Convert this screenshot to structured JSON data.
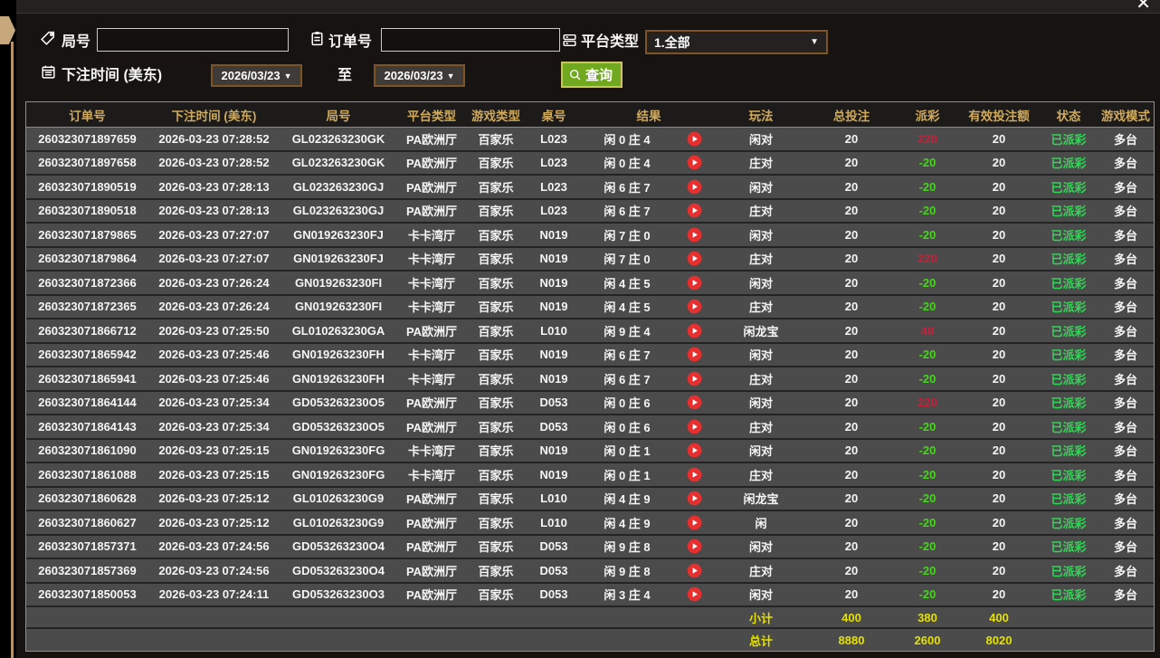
{
  "window": {
    "close_icon": "✕"
  },
  "colors": {
    "header_gold": "#cfa95c",
    "payout_negative_green": "#46d41c",
    "payout_positive_red": "#c3223a",
    "status_green": "#30d754",
    "totals_yellow": "#e4e000",
    "query_button_green": "#70a91f",
    "row_gray": "#4b4b4b"
  },
  "toolbar": {
    "round_label": "局号",
    "round_input_value": "",
    "round_input_placeholder": "",
    "order_label": "订单号",
    "order_input_value": "",
    "order_input_placeholder": "",
    "platform_label": "平台类型",
    "platform_value": "1.全部",
    "dropdown_arrow": "▼",
    "bet_time_label": "下注时间 (美东)",
    "date_from": "2026/03/23",
    "to_label": "至",
    "date_to": "2026/03/23",
    "query_label": "查询"
  },
  "table": {
    "headers": [
      "订单号",
      "下注时间 (美东)",
      "局号",
      "平台类型",
      "游戏类型",
      "桌号",
      "结果",
      "玩法",
      "总投注",
      "派彩",
      "有效投注额",
      "状态",
      "游戏模式"
    ],
    "rows": [
      {
        "order": "260323071897659",
        "time": "2026-03-23 07:28:52",
        "round": "GL023263230GK",
        "platform": "PA欧洲厅",
        "game": "百家乐",
        "table": "L023",
        "result": "闲 0 庄 4",
        "play": "闲对",
        "total": "20",
        "payout": "220",
        "valid": "20",
        "status": "已派彩",
        "mode": "多台"
      },
      {
        "order": "260323071897658",
        "time": "2026-03-23 07:28:52",
        "round": "GL023263230GK",
        "platform": "PA欧洲厅",
        "game": "百家乐",
        "table": "L023",
        "result": "闲 0 庄 4",
        "play": "庄对",
        "total": "20",
        "payout": "-20",
        "valid": "20",
        "status": "已派彩",
        "mode": "多台"
      },
      {
        "order": "260323071890519",
        "time": "2026-03-23 07:28:13",
        "round": "GL023263230GJ",
        "platform": "PA欧洲厅",
        "game": "百家乐",
        "table": "L023",
        "result": "闲 6 庄 7",
        "play": "闲对",
        "total": "20",
        "payout": "-20",
        "valid": "20",
        "status": "已派彩",
        "mode": "多台"
      },
      {
        "order": "260323071890518",
        "time": "2026-03-23 07:28:13",
        "round": "GL023263230GJ",
        "platform": "PA欧洲厅",
        "game": "百家乐",
        "table": "L023",
        "result": "闲 6 庄 7",
        "play": "庄对",
        "total": "20",
        "payout": "-20",
        "valid": "20",
        "status": "已派彩",
        "mode": "多台"
      },
      {
        "order": "260323071879865",
        "time": "2026-03-23 07:27:07",
        "round": "GN019263230FJ",
        "platform": "卡卡湾厅",
        "game": "百家乐",
        "table": "N019",
        "result": "闲 7 庄 0",
        "play": "闲对",
        "total": "20",
        "payout": "-20",
        "valid": "20",
        "status": "已派彩",
        "mode": "多台"
      },
      {
        "order": "260323071879864",
        "time": "2026-03-23 07:27:07",
        "round": "GN019263230FJ",
        "platform": "卡卡湾厅",
        "game": "百家乐",
        "table": "N019",
        "result": "闲 7 庄 0",
        "play": "庄对",
        "total": "20",
        "payout": "220",
        "valid": "20",
        "status": "已派彩",
        "mode": "多台"
      },
      {
        "order": "260323071872366",
        "time": "2026-03-23 07:26:24",
        "round": "GN019263230FI",
        "platform": "卡卡湾厅",
        "game": "百家乐",
        "table": "N019",
        "result": "闲 4 庄 5",
        "play": "闲对",
        "total": "20",
        "payout": "-20",
        "valid": "20",
        "status": "已派彩",
        "mode": "多台"
      },
      {
        "order": "260323071872365",
        "time": "2026-03-23 07:26:24",
        "round": "GN019263230FI",
        "platform": "卡卡湾厅",
        "game": "百家乐",
        "table": "N019",
        "result": "闲 4 庄 5",
        "play": "庄对",
        "total": "20",
        "payout": "-20",
        "valid": "20",
        "status": "已派彩",
        "mode": "多台"
      },
      {
        "order": "260323071866712",
        "time": "2026-03-23 07:25:50",
        "round": "GL010263230GA",
        "platform": "PA欧洲厅",
        "game": "百家乐",
        "table": "L010",
        "result": "闲 9 庄 4",
        "play": "闲龙宝",
        "total": "20",
        "payout": "40",
        "valid": "20",
        "status": "已派彩",
        "mode": "多台"
      },
      {
        "order": "260323071865942",
        "time": "2026-03-23 07:25:46",
        "round": "GN019263230FH",
        "platform": "卡卡湾厅",
        "game": "百家乐",
        "table": "N019",
        "result": "闲 6 庄 7",
        "play": "闲对",
        "total": "20",
        "payout": "-20",
        "valid": "20",
        "status": "已派彩",
        "mode": "多台"
      },
      {
        "order": "260323071865941",
        "time": "2026-03-23 07:25:46",
        "round": "GN019263230FH",
        "platform": "卡卡湾厅",
        "game": "百家乐",
        "table": "N019",
        "result": "闲 6 庄 7",
        "play": "庄对",
        "total": "20",
        "payout": "-20",
        "valid": "20",
        "status": "已派彩",
        "mode": "多台"
      },
      {
        "order": "260323071864144",
        "time": "2026-03-23 07:25:34",
        "round": "GD053263230O5",
        "platform": "PA欧洲厅",
        "game": "百家乐",
        "table": "D053",
        "result": "闲 0 庄 6",
        "play": "闲对",
        "total": "20",
        "payout": "220",
        "valid": "20",
        "status": "已派彩",
        "mode": "多台"
      },
      {
        "order": "260323071864143",
        "time": "2026-03-23 07:25:34",
        "round": "GD053263230O5",
        "platform": "PA欧洲厅",
        "game": "百家乐",
        "table": "D053",
        "result": "闲 0 庄 6",
        "play": "庄对",
        "total": "20",
        "payout": "-20",
        "valid": "20",
        "status": "已派彩",
        "mode": "多台"
      },
      {
        "order": "260323071861090",
        "time": "2026-03-23 07:25:15",
        "round": "GN019263230FG",
        "platform": "卡卡湾厅",
        "game": "百家乐",
        "table": "N019",
        "result": "闲 0 庄 1",
        "play": "闲对",
        "total": "20",
        "payout": "-20",
        "valid": "20",
        "status": "已派彩",
        "mode": "多台"
      },
      {
        "order": "260323071861088",
        "time": "2026-03-23 07:25:15",
        "round": "GN019263230FG",
        "platform": "卡卡湾厅",
        "game": "百家乐",
        "table": "N019",
        "result": "闲 0 庄 1",
        "play": "庄对",
        "total": "20",
        "payout": "-20",
        "valid": "20",
        "status": "已派彩",
        "mode": "多台"
      },
      {
        "order": "260323071860628",
        "time": "2026-03-23 07:25:12",
        "round": "GL010263230G9",
        "platform": "PA欧洲厅",
        "game": "百家乐",
        "table": "L010",
        "result": "闲 4 庄 9",
        "play": "闲龙宝",
        "total": "20",
        "payout": "-20",
        "valid": "20",
        "status": "已派彩",
        "mode": "多台"
      },
      {
        "order": "260323071860627",
        "time": "2026-03-23 07:25:12",
        "round": "GL010263230G9",
        "platform": "PA欧洲厅",
        "game": "百家乐",
        "table": "L010",
        "result": "闲 4 庄 9",
        "play": "闲",
        "total": "20",
        "payout": "-20",
        "valid": "20",
        "status": "已派彩",
        "mode": "多台"
      },
      {
        "order": "260323071857371",
        "time": "2026-03-23 07:24:56",
        "round": "GD053263230O4",
        "platform": "PA欧洲厅",
        "game": "百家乐",
        "table": "D053",
        "result": "闲 9 庄 8",
        "play": "闲对",
        "total": "20",
        "payout": "-20",
        "valid": "20",
        "status": "已派彩",
        "mode": "多台"
      },
      {
        "order": "260323071857369",
        "time": "2026-03-23 07:24:56",
        "round": "GD053263230O4",
        "platform": "PA欧洲厅",
        "game": "百家乐",
        "table": "D053",
        "result": "闲 9 庄 8",
        "play": "庄对",
        "total": "20",
        "payout": "-20",
        "valid": "20",
        "status": "已派彩",
        "mode": "多台"
      },
      {
        "order": "260323071850053",
        "time": "2026-03-23 07:24:11",
        "round": "GD053263230O3",
        "platform": "PA欧洲厅",
        "game": "百家乐",
        "table": "D053",
        "result": "闲 3 庄 4",
        "play": "闲对",
        "total": "20",
        "payout": "-20",
        "valid": "20",
        "status": "已派彩",
        "mode": "多台"
      }
    ],
    "subtotal": {
      "label": "小计",
      "total": "400",
      "payout": "380",
      "valid": "400"
    },
    "grand_total": {
      "label": "总计",
      "total": "8880",
      "payout": "2600",
      "valid": "8020"
    }
  }
}
